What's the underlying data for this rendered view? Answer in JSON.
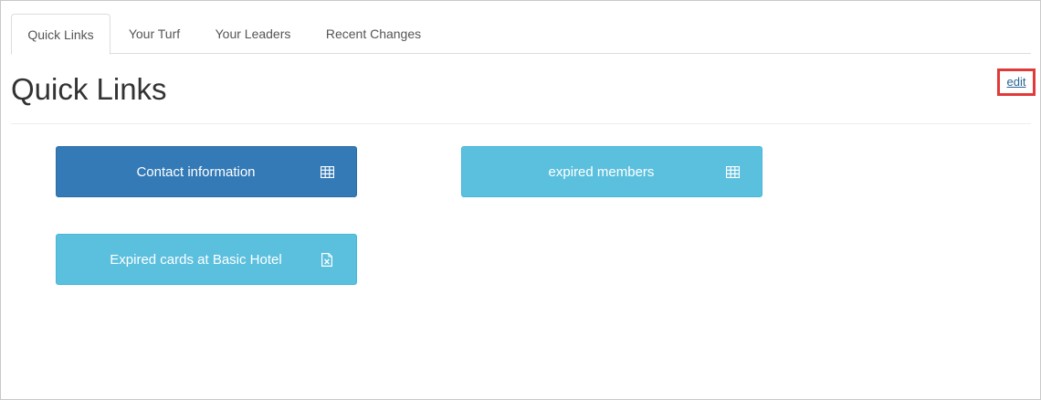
{
  "tabs": [
    {
      "label": "Quick Links",
      "active": true
    },
    {
      "label": "Your Turf",
      "active": false
    },
    {
      "label": "Your Leaders",
      "active": false
    },
    {
      "label": "Recent Changes",
      "active": false
    }
  ],
  "page": {
    "title": "Quick Links",
    "edit_label": "edit"
  },
  "links": [
    {
      "label": "Contact information",
      "icon": "table-icon",
      "style": "primary",
      "color": "#337ab7"
    },
    {
      "label": "expired members",
      "icon": "table-icon",
      "style": "info",
      "color": "#5bc0de"
    },
    {
      "label": "Expired cards at Basic Hotel",
      "icon": "excel-file-icon",
      "style": "info",
      "color": "#5bc0de"
    }
  ],
  "colors": {
    "primary": "#337ab7",
    "info": "#5bc0de",
    "link": "#2a6496",
    "highlight": "#e03a3a"
  }
}
